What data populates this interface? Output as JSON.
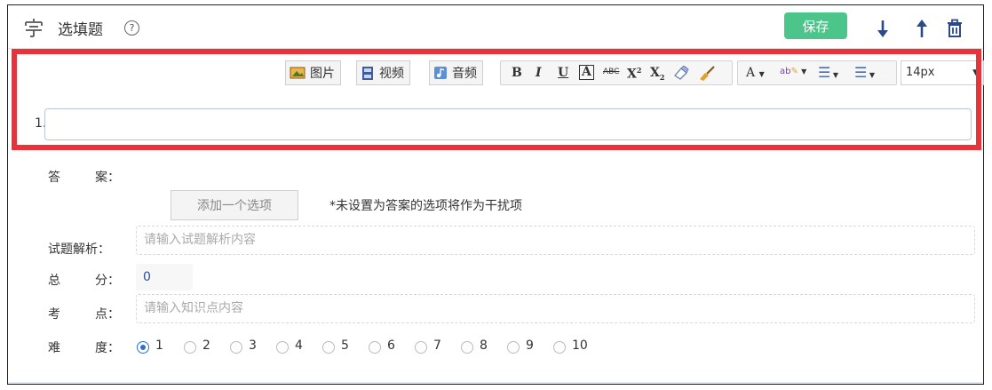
{
  "header": {
    "title": "选填题",
    "help": "?",
    "save_label": "保存",
    "icons": [
      "grip-icon",
      "help-icon",
      "arrow-down-icon",
      "arrow-up-icon",
      "trash-icon"
    ]
  },
  "toolbar": {
    "image_label": "图片",
    "video_label": "视频",
    "audio_label": "音频",
    "bold": "B",
    "italic": "I",
    "underline": "U",
    "border_a": "A",
    "strike": "ABC",
    "sup_x": "X",
    "sup_n": "2",
    "sub_x": "X",
    "sub_n": "2",
    "font_color": "A",
    "highlight": "ab",
    "font_size": "14px"
  },
  "question": {
    "number": "1."
  },
  "answer": {
    "label_a": "答",
    "label_b": "案：",
    "add_option_label": "添加一个选项",
    "note": "*未设置为答案的选项将作为干扰项"
  },
  "analysis": {
    "label": "试题解析：",
    "placeholder": "请输入试题解析内容"
  },
  "score": {
    "label_a": "总",
    "label_b": "分：",
    "value": "0"
  },
  "knowledge": {
    "label_a": "考",
    "label_b": "点：",
    "placeholder": "请输入知识点内容"
  },
  "difficulty": {
    "label_a": "难",
    "label_b": "度：",
    "options": [
      "1",
      "2",
      "3",
      "4",
      "5",
      "6",
      "7",
      "8",
      "9",
      "10"
    ],
    "selected": "1"
  },
  "colors": {
    "save": "#4cc58b",
    "highlight_border": "#e8333a",
    "radio_checked": "#2c6fcf"
  }
}
